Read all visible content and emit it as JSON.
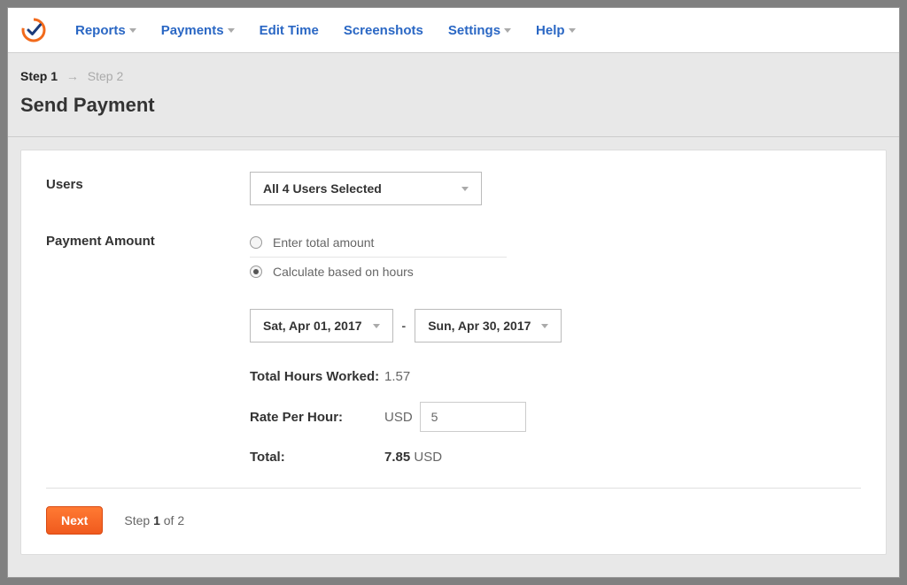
{
  "nav": {
    "items": [
      {
        "label": "Reports",
        "dropdown": true
      },
      {
        "label": "Payments",
        "dropdown": true
      },
      {
        "label": "Edit Time",
        "dropdown": false
      },
      {
        "label": "Screenshots",
        "dropdown": false
      },
      {
        "label": "Settings",
        "dropdown": true
      },
      {
        "label": "Help",
        "dropdown": true
      }
    ]
  },
  "steps": {
    "active": "Step 1",
    "inactive": "Step 2"
  },
  "page_title": "Send Payment",
  "users": {
    "label": "Users",
    "selected": "All 4 Users Selected"
  },
  "payment_amount": {
    "label": "Payment Amount",
    "options": [
      "Enter total amount",
      "Calculate based on hours"
    ],
    "selected_index": 1
  },
  "date_range": {
    "start": "Sat, Apr 01, 2017",
    "end": "Sun, Apr 30, 2017"
  },
  "totals": {
    "hours_label": "Total Hours Worked:",
    "hours_value": "1.57",
    "rate_label": "Rate Per Hour:",
    "currency": "USD",
    "rate_value": "5",
    "total_label": "Total:",
    "total_value": "7.85",
    "total_currency": "USD"
  },
  "footer": {
    "next": "Next",
    "note_prefix": "Step ",
    "note_bold": "1",
    "note_suffix": " of 2"
  }
}
